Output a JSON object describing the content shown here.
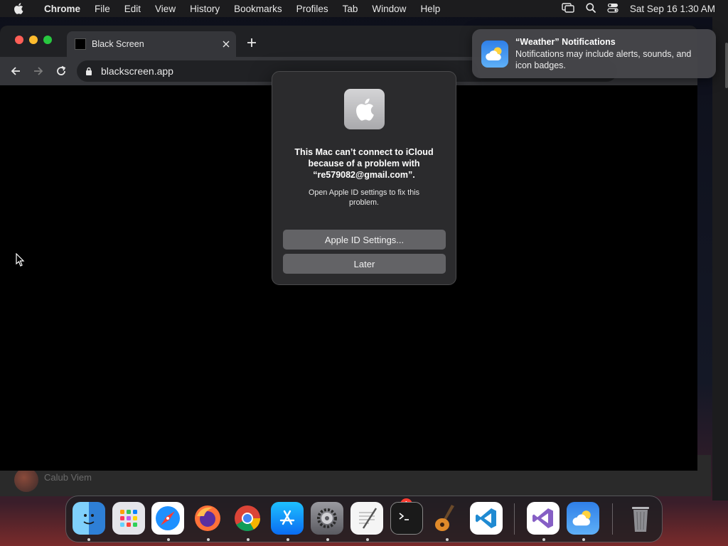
{
  "menubar": {
    "app_name": "Chrome",
    "items": [
      "File",
      "Edit",
      "View",
      "History",
      "Bookmarks",
      "Profiles",
      "Tab",
      "Window",
      "Help"
    ],
    "clock": "Sat Sep 16  1:30 AM",
    "status_icons": [
      "screen-mirroring-icon",
      "spotlight-search-icon",
      "control-center-icon"
    ]
  },
  "browser": {
    "tab_title": "Black Screen",
    "url": "blackscreen.app"
  },
  "background_window": {
    "label": "Calub Viem"
  },
  "dialog": {
    "heading": "This Mac can’t connect to iCloud because of a problem with “re579082@gmail.com”.",
    "body": "Open Apple ID settings to fix this problem.",
    "primary_button": "Apple ID Settings...",
    "secondary_button": "Later"
  },
  "notification": {
    "title": "“Weather” Notifications",
    "body": "Notifications may include alerts, sounds, and icon badges."
  },
  "dock": {
    "items": [
      "Finder",
      "Launchpad",
      "Safari",
      "Firefox",
      "Chrome",
      "App Store",
      "System Settings",
      "TextEdit",
      "Terminal",
      "GarageBand",
      "Visual Studio Code",
      "Visual Studio",
      "Weather",
      "Trash"
    ],
    "system_settings_badge": "1"
  },
  "colors": {
    "menubar": "#1c1c1e",
    "dialog_bg": "#2b2b2d",
    "dialog_button": "#636366",
    "traffic_red": "#ff5f57",
    "traffic_yellow": "#febc2e",
    "traffic_green": "#28c840"
  }
}
